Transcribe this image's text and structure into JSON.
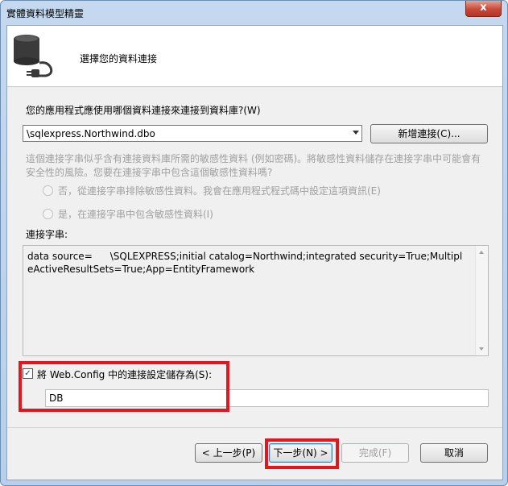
{
  "window": {
    "title": "實體資料模型精靈",
    "close_glyph": "x"
  },
  "header": {
    "title": "選擇您的資料連接",
    "icon": "database-plug-icon"
  },
  "connection_prompt": "您的應用程式應使用哪個資料連接來連接到資料庫?(W)",
  "connection_select": {
    "value": "\\sqlexpress.Northwind.dbo"
  },
  "new_connection_button": "新增連接(C)...",
  "sensitive_notice": "這個連接字串似乎含有連接資料庫所需的敏感性資料 (例如密碼)。將敏感性資料儲存在連接字串中可能會有安全性的風險。您要在連接字串中包含這個敏感性資料嗎?",
  "radio_exclude": "否，從連接字串排除敏感性資料。我會在應用程式程式碼中設定這項資訊(E)",
  "radio_include": "是，在連接字串中包含敏感性資料(I)",
  "connection_string": {
    "label": "連接字串:",
    "part1": "data source=",
    "part2": "\\SQLEXPRESS;initial catalog=Northwind;integrated security=True;MultipleActiveResultSets=True;App=EntityFramework"
  },
  "save_setting": {
    "checked": true,
    "check_glyph": "✓",
    "label": "將 Web.Config 中的連接設定儲存為(S):",
    "value": "DB"
  },
  "footer": {
    "back": "< 上一步(P)",
    "next": "下一步(N) >",
    "finish": "完成(F)",
    "cancel": "取消"
  },
  "colors": {
    "highlight": "#e3151d",
    "title_bar": "#c4d9ef"
  }
}
